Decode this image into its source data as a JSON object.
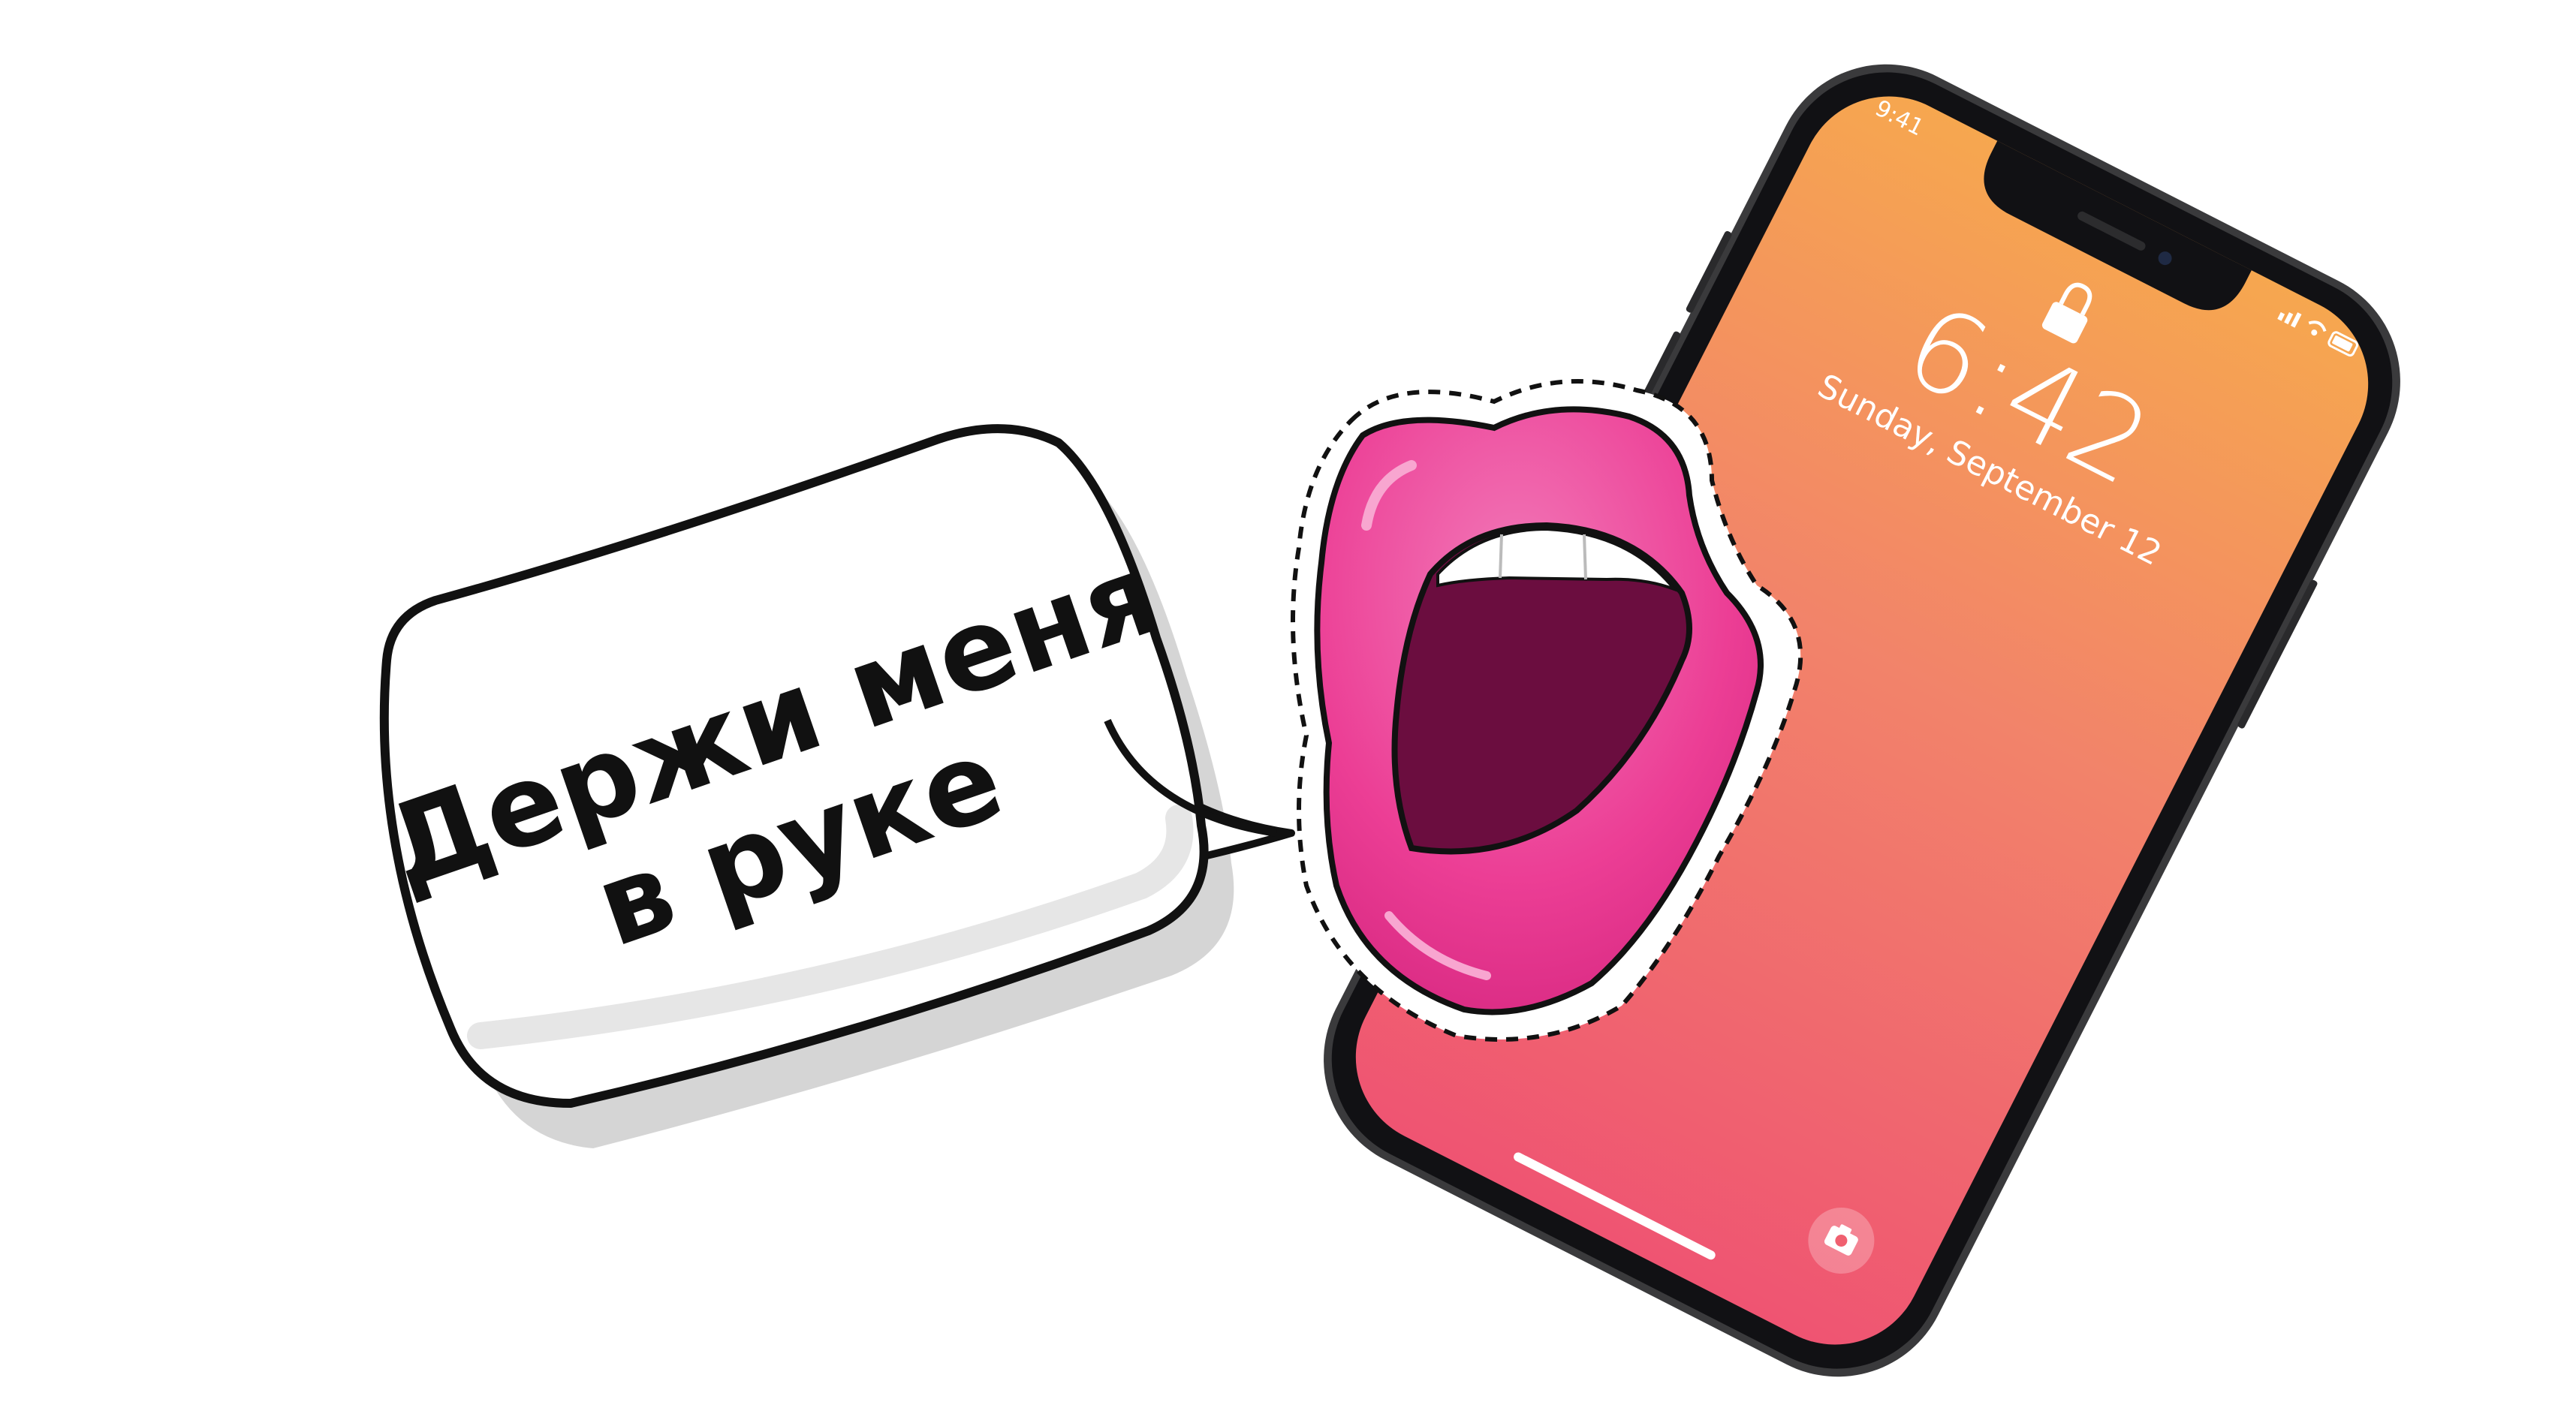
{
  "speech_bubble": {
    "line1": "Держи меня",
    "line2": "в руке"
  },
  "phone": {
    "status_time": "9:41",
    "clock": "6:42",
    "date": "Sunday, September 12",
    "icons": [
      "lock-icon",
      "camera-icon",
      "signal-icon",
      "wifi-icon",
      "battery-icon"
    ]
  },
  "colors": {
    "screen_top": "#F6A74F",
    "screen_bottom": "#EF5472",
    "lips": "#EC3E95",
    "mouth": "#6B0D3F",
    "frame": "#1C1C1E"
  }
}
